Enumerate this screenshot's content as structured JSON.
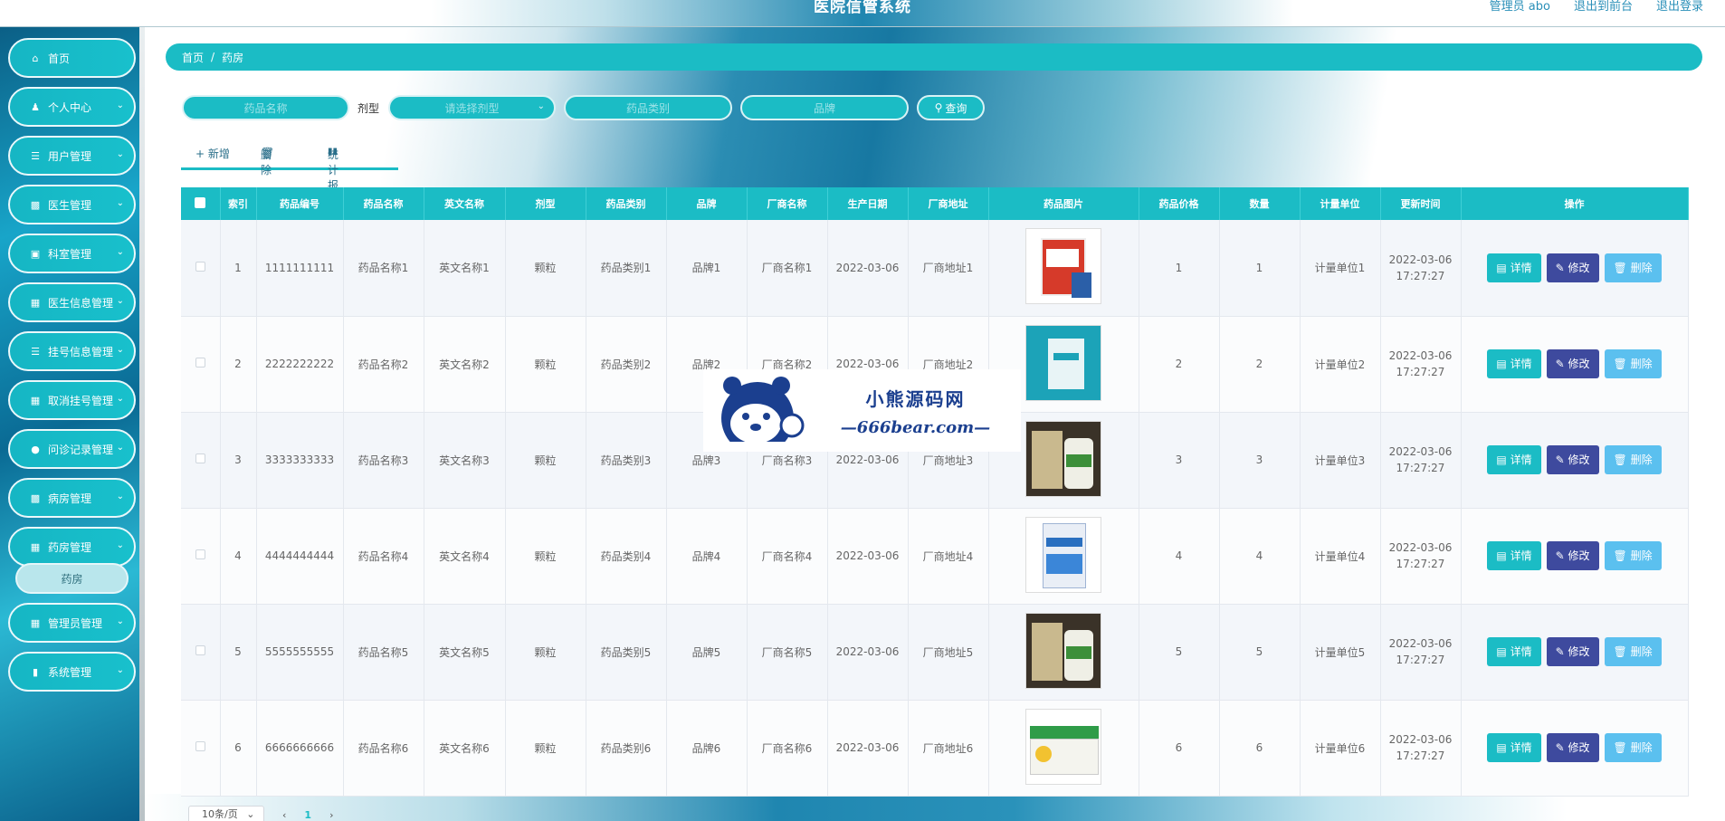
{
  "header": {
    "title": "医院信管系统",
    "user_label": "管理员 abo",
    "front_link": "退出到前台",
    "logout_link": "退出登录"
  },
  "sidebar": {
    "items": [
      {
        "label": "首页",
        "icon": "home-icon"
      },
      {
        "label": "个人中心",
        "icon": "user-icon"
      },
      {
        "label": "用户管理",
        "icon": "sliders-icon"
      },
      {
        "label": "医生管理",
        "icon": "cylinder-icon"
      },
      {
        "label": "科室管理",
        "icon": "inbox-icon"
      },
      {
        "label": "医生信息管理",
        "icon": "grid-icon"
      },
      {
        "label": "挂号信息管理",
        "icon": "list-icon"
      },
      {
        "label": "取消挂号管理",
        "icon": "grid-icon"
      },
      {
        "label": "问诊记录管理",
        "icon": "pin-icon"
      },
      {
        "label": "病房管理",
        "icon": "cup-icon"
      },
      {
        "label": "药房管理",
        "icon": "grid-icon"
      },
      {
        "label": "管理员管理",
        "icon": "grid-icon"
      },
      {
        "label": "系统管理",
        "icon": "book-icon"
      }
    ],
    "submenu_label": "药房"
  },
  "breadcrumb": {
    "home": "首页",
    "sep": "/",
    "current": "药房"
  },
  "search": {
    "name_placeholder": "药品名称",
    "dosage_label": "剂型",
    "dosage_placeholder": "请选择剂型",
    "category_placeholder": "药品类别",
    "brand_placeholder": "品牌",
    "query_label": "查询"
  },
  "actions": {
    "add": "+ 新增",
    "delete": "删除",
    "stats": "统计报表"
  },
  "table": {
    "headers": [
      "索引",
      "药品编号",
      "药品名称",
      "英文名称",
      "剂型",
      "药品类别",
      "品牌",
      "厂商名称",
      "生产日期",
      "厂商地址",
      "药品图片",
      "药品价格",
      "数量",
      "计量单位",
      "更新时间",
      "操作"
    ],
    "rows": [
      {
        "idx": "1",
        "code": "1111111111",
        "name": "药品名称1",
        "en": "英文名称1",
        "form": "颗粒",
        "cat": "药品类别1",
        "brand": "品牌1",
        "maker": "厂商名称1",
        "date": "2022-03-06",
        "addr": "厂商地址1",
        "price": "1",
        "qty": "1",
        "unit": "计量单位1",
        "upd1": "2022-03-06",
        "upd2": "17:27:27"
      },
      {
        "idx": "2",
        "code": "2222222222",
        "name": "药品名称2",
        "en": "英文名称2",
        "form": "颗粒",
        "cat": "药品类别2",
        "brand": "品牌2",
        "maker": "厂商名称2",
        "date": "2022-03-06",
        "addr": "厂商地址2",
        "price": "2",
        "qty": "2",
        "unit": "计量单位2",
        "upd1": "2022-03-06",
        "upd2": "17:27:27"
      },
      {
        "idx": "3",
        "code": "3333333333",
        "name": "药品名称3",
        "en": "英文名称3",
        "form": "颗粒",
        "cat": "药品类别3",
        "brand": "品牌3",
        "maker": "厂商名称3",
        "date": "2022-03-06",
        "addr": "厂商地址3",
        "price": "3",
        "qty": "3",
        "unit": "计量单位3",
        "upd1": "2022-03-06",
        "upd2": "17:27:27"
      },
      {
        "idx": "4",
        "code": "4444444444",
        "name": "药品名称4",
        "en": "英文名称4",
        "form": "颗粒",
        "cat": "药品类别4",
        "brand": "品牌4",
        "maker": "厂商名称4",
        "date": "2022-03-06",
        "addr": "厂商地址4",
        "price": "4",
        "qty": "4",
        "unit": "计量单位4",
        "upd1": "2022-03-06",
        "upd2": "17:27:27"
      },
      {
        "idx": "5",
        "code": "5555555555",
        "name": "药品名称5",
        "en": "英文名称5",
        "form": "颗粒",
        "cat": "药品类别5",
        "brand": "品牌5",
        "maker": "厂商名称5",
        "date": "2022-03-06",
        "addr": "厂商地址5",
        "price": "5",
        "qty": "5",
        "unit": "计量单位5",
        "upd1": "2022-03-06",
        "upd2": "17:27:27"
      },
      {
        "idx": "6",
        "code": "6666666666",
        "name": "药品名称6",
        "en": "英文名称6",
        "form": "颗粒",
        "cat": "药品类别6",
        "brand": "品牌6",
        "maker": "厂商名称6",
        "date": "2022-03-06",
        "addr": "厂商地址6",
        "price": "6",
        "qty": "6",
        "unit": "计量单位6",
        "upd1": "2022-03-06",
        "upd2": "17:27:27"
      }
    ],
    "row_buttons": {
      "detail": "详情",
      "edit": "修改",
      "delete": "删除"
    }
  },
  "watermark": {
    "line1": "小熊源码网",
    "line2": "—666bear.com—"
  },
  "pager": {
    "page_size": "10条/页",
    "prev": "‹",
    "page": "1",
    "next": "›"
  },
  "colors": {
    "accent": "#1bbcc5",
    "edit": "#3e4a9e",
    "delete": "#5bc0ef"
  }
}
